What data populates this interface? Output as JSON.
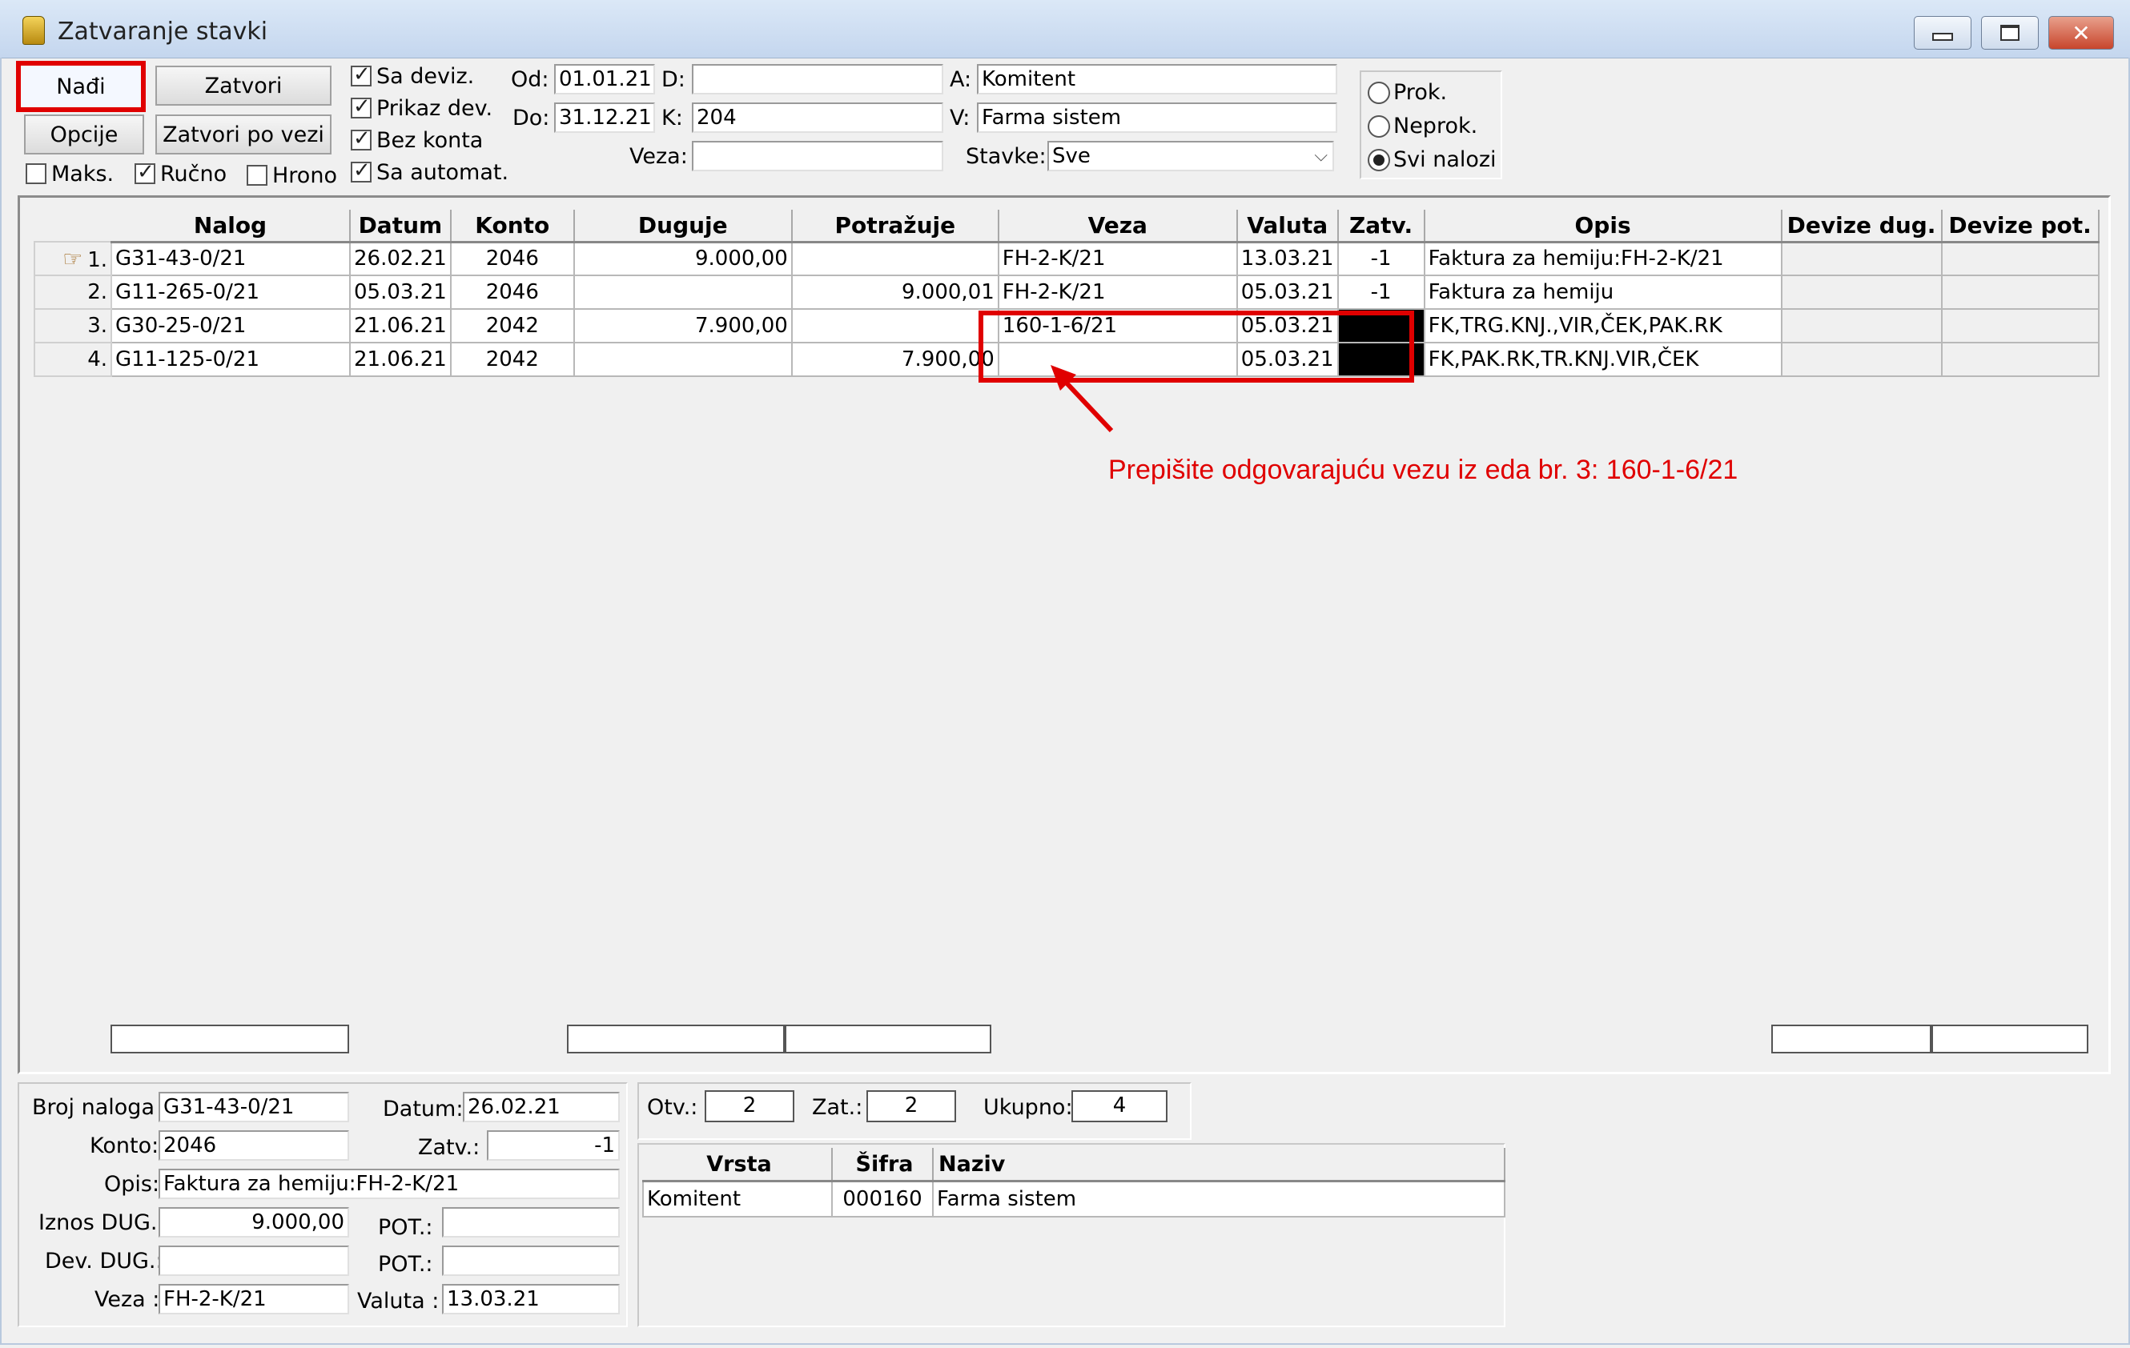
{
  "window": {
    "title": "Zatvaranje stavki"
  },
  "toolbar": {
    "find_label": "Nađi",
    "close_label": "Zatvori",
    "options_label": "Opcije",
    "close_by_link_label": "Zatvori po vezi"
  },
  "checks": {
    "maks": {
      "label": "Maks.",
      "checked": false
    },
    "rucno": {
      "label": "Ručno",
      "checked": true
    },
    "hrono": {
      "label": "Hrono",
      "checked": false
    },
    "sa_deviz": {
      "label": "Sa deviz.",
      "checked": true
    },
    "prikaz_dev": {
      "label": "Prikaz dev.",
      "checked": true
    },
    "bez_konta": {
      "label": "Bez konta",
      "checked": true
    },
    "sa_automat": {
      "label": "Sa automat.",
      "checked": true
    }
  },
  "filters": {
    "od_label": "Od:",
    "od_value": "01.01.21",
    "do_label": "Do:",
    "do_value": "31.12.21",
    "d_label": "D:",
    "d_value": "",
    "k_label": "K:",
    "k_value": "204",
    "veza_label": "Veza:",
    "veza_value": "",
    "a_label": "A:",
    "a_value": "Komitent",
    "v_label": "V:",
    "v_value": "Farma sistem",
    "stavke_label": "Stavke:",
    "stavke_value": "Sve"
  },
  "radios": [
    {
      "label": "Prok.",
      "selected": false
    },
    {
      "label": "Neprok.",
      "selected": false
    },
    {
      "label": "Svi nalozi",
      "selected": true
    }
  ],
  "grid": {
    "columns": [
      "Nalog",
      "Datum",
      "Konto",
      "Duguje",
      "Potražuje",
      "Veza",
      "Valuta",
      "Zatv.",
      "Opis",
      "Devize dug.",
      "Devize pot."
    ],
    "rows": [
      {
        "num": "1.",
        "nalog": "G31-43-0/21",
        "datum": "26.02.21",
        "konto": "2046",
        "duguje": "9.000,00",
        "potrazuje": "",
        "veza": "FH-2-K/21",
        "valuta": "13.03.21",
        "zatv": "-1",
        "opis": "Faktura za hemiju:FH-2-K/21"
      },
      {
        "num": "2.",
        "nalog": "G11-265-0/21",
        "datum": "05.03.21",
        "konto": "2046",
        "duguje": "",
        "potrazuje": "9.000,01",
        "veza": "FH-2-K/21",
        "valuta": "05.03.21",
        "zatv": "-1",
        "opis": "Faktura za hemiju"
      },
      {
        "num": "3.",
        "nalog": "G30-25-0/21",
        "datum": "21.06.21",
        "konto": "2042",
        "duguje": "7.900,00",
        "potrazuje": "",
        "veza": "160-1-6/21",
        "valuta": "05.03.21",
        "zatv": "",
        "opis": "FK,TRG.KNJ.,VIR,ČEK,PAK.RK"
      },
      {
        "num": "4.",
        "nalog": "G11-125-0/21",
        "datum": "21.06.21",
        "konto": "2042",
        "duguje": "",
        "potrazuje": "7.900,00",
        "veza": "",
        "valuta": "05.03.21",
        "zatv": "",
        "opis": "FK,PAK.RK,TR.KNJ.VIR,ČEK"
      }
    ]
  },
  "annotation": "Prepišite odgovarajuću vezu iz eda br. 3: 160-1-6/21",
  "detail": {
    "broj_naloga_label": "Broj naloga :",
    "broj_naloga": "G31-43-0/21",
    "datum_label": "Datum:",
    "datum": "26.02.21",
    "konto_label": "Konto:",
    "konto": "2046",
    "zatv_label": "Zatv.:",
    "zatv": "-1",
    "opis_label": "Opis:",
    "opis": "Faktura za hemiju:FH-2-K/21",
    "iznos_dug_label": "Iznos DUG.:",
    "iznos_dug": "9.000,00",
    "pot_label": "POT.:",
    "pot": "",
    "dev_dug_label": "Dev. DUG.:",
    "dev_dug": "",
    "dev_pot_label": "POT.:",
    "dev_pot": "",
    "veza_label": "Veza :",
    "veza": "FH-2-K/21",
    "valuta_label": "Valuta :",
    "valuta": "13.03.21"
  },
  "counts": {
    "otv_label": "Otv.:",
    "otv": "2",
    "zat_label": "Zat.:",
    "zat": "2",
    "ukupno_label": "Ukupno:",
    "ukupno": "4"
  },
  "partner": {
    "columns": [
      "Vrsta",
      "Šifra",
      "Naziv"
    ],
    "rows": [
      {
        "vrsta": "Komitent",
        "sifra": "000160",
        "naziv": "Farma sistem"
      }
    ]
  }
}
